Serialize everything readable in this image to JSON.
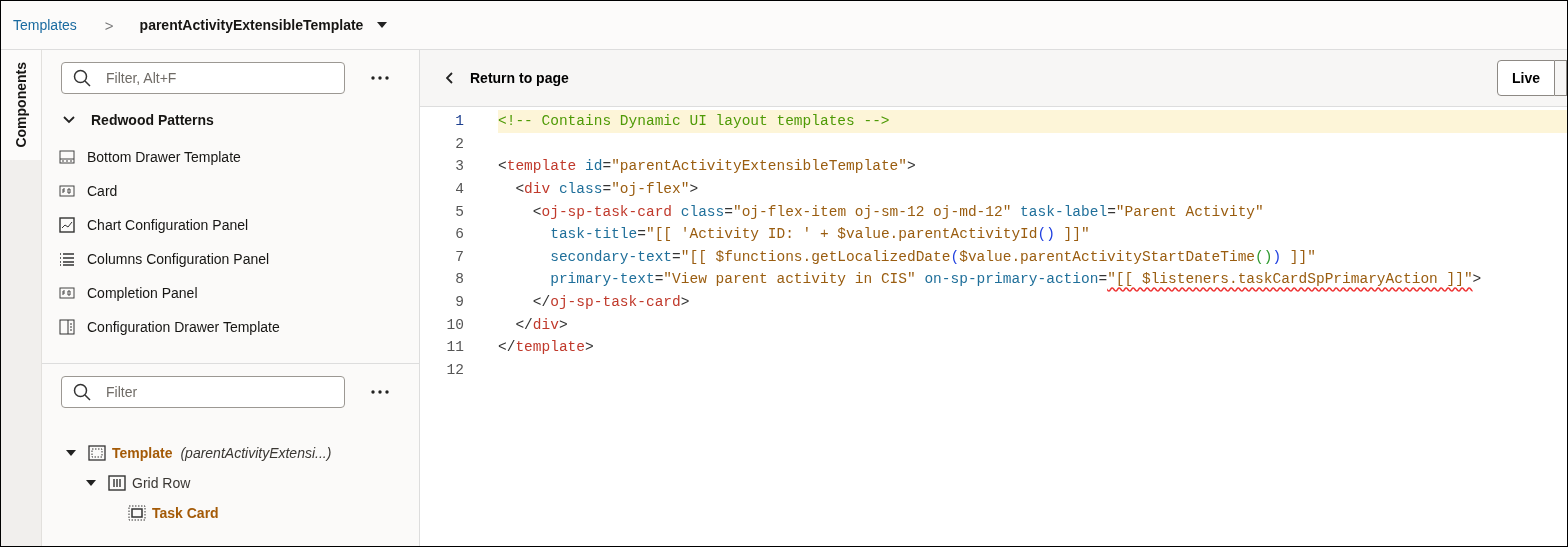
{
  "breadcrumb": {
    "parent": "Templates",
    "separator": ">",
    "current": "parentActivityExtensibleTemplate"
  },
  "side_tab": {
    "label": "Components",
    "selected": true
  },
  "components_panel": {
    "filter_placeholder": "Filter, Alt+F",
    "group": {
      "label": "Redwood Patterns",
      "expanded": true
    },
    "items": [
      {
        "label": "Bottom Drawer Template",
        "kind": "drawer"
      },
      {
        "label": "Card",
        "kind": "card"
      },
      {
        "label": "Chart Configuration Panel",
        "kind": "chart"
      },
      {
        "label": "Columns Configuration Panel",
        "kind": "list"
      },
      {
        "label": "Completion Panel",
        "kind": "card"
      },
      {
        "label": "Configuration Drawer Template",
        "kind": "panel"
      }
    ]
  },
  "structure_panel": {
    "filter_placeholder": "Filter",
    "tree": [
      {
        "label": "Template",
        "detail": "(parentActivityExtensi...)",
        "kind": "template",
        "emphasized": true,
        "expanded": true,
        "children": [
          {
            "label": "Grid Row",
            "kind": "grid",
            "emphasized": false,
            "expanded": true,
            "children": [
              {
                "label": "Task Card",
                "kind": "card",
                "emphasized": true
              }
            ]
          }
        ]
      }
    ]
  },
  "editor": {
    "back_label": "Return to page",
    "mode_button": "Live",
    "lines": [
      {
        "number": "1",
        "current": true,
        "tokens": [
          {
            "kind": "comment",
            "text": "<!-- Contains Dynamic UI layout templates -->"
          }
        ]
      },
      {
        "number": "2",
        "current": false
      },
      {
        "number": "3",
        "current": false,
        "tokens": [
          {
            "kind": "punct",
            "text": "<"
          },
          {
            "kind": "tag",
            "text": "template"
          },
          {
            "kind": "attr",
            "text": " id"
          },
          {
            "kind": "punct",
            "text": "="
          },
          {
            "kind": "string",
            "text": "\"parentActivityExtensibleTemplate\""
          },
          {
            "kind": "punct",
            "text": ">"
          }
        ]
      },
      {
        "number": "4",
        "current": false,
        "tokens": [
          {
            "kind": "punct",
            "text": "  <"
          },
          {
            "kind": "tag",
            "text": "div"
          },
          {
            "kind": "attr",
            "text": " class"
          },
          {
            "kind": "punct",
            "text": "="
          },
          {
            "kind": "string",
            "text": "\"oj-flex\""
          },
          {
            "kind": "punct",
            "text": ">"
          }
        ]
      },
      {
        "number": "5",
        "current": false,
        "tokens": [
          {
            "kind": "punct",
            "text": "    <"
          },
          {
            "kind": "tag",
            "text": "oj-sp-task-card"
          },
          {
            "kind": "attr",
            "text": " class"
          },
          {
            "kind": "punct",
            "text": "="
          },
          {
            "kind": "string",
            "text": "\"oj-flex-item oj-sm-12 oj-md-12\""
          },
          {
            "kind": "attr",
            "text": " task-label"
          },
          {
            "kind": "punct",
            "text": "="
          },
          {
            "kind": "string",
            "text": "\"Parent Activity\""
          }
        ]
      },
      {
        "number": "6",
        "current": false,
        "tokens": [
          {
            "kind": "attr",
            "text": "      task-title"
          },
          {
            "kind": "punct",
            "text": "="
          },
          {
            "kind": "string",
            "text": "\"[[ 'Activity ID: ' + $value.parentActivityId"
          },
          {
            "kind": "paren",
            "text": "()"
          },
          {
            "kind": "string",
            "text": " ]]\""
          }
        ]
      },
      {
        "number": "7",
        "current": false,
        "tokens": [
          {
            "kind": "attr",
            "text": "      secondary-text"
          },
          {
            "kind": "punct",
            "text": "="
          },
          {
            "kind": "string",
            "text": "\"[[ $functions.getLocalizedDate"
          },
          {
            "kind": "paren",
            "text": "("
          },
          {
            "kind": "string",
            "text": "$value.parentActivityStartDateTime"
          },
          {
            "kind": "paren2",
            "text": "()"
          },
          {
            "kind": "paren",
            "text": ")"
          },
          {
            "kind": "string",
            "text": " ]]\""
          }
        ]
      },
      {
        "number": "8",
        "current": false,
        "tokens": [
          {
            "kind": "attr",
            "text": "      primary-text"
          },
          {
            "kind": "punct",
            "text": "="
          },
          {
            "kind": "string",
            "text": "\"View parent activity in CIS\""
          },
          {
            "kind": "attr",
            "text": " on-sp-primary-action"
          },
          {
            "kind": "punct",
            "text": "="
          },
          {
            "kind": "error",
            "text": "\"[[ $listeners.taskCardSpPrimaryAction ]]\""
          },
          {
            "kind": "punct",
            "text": ">"
          }
        ]
      },
      {
        "number": "9",
        "current": false,
        "tokens": [
          {
            "kind": "punct",
            "text": "    </"
          },
          {
            "kind": "tag",
            "text": "oj-sp-task-card"
          },
          {
            "kind": "punct",
            "text": ">"
          }
        ]
      },
      {
        "number": "10",
        "current": false,
        "tokens": [
          {
            "kind": "punct",
            "text": "  </"
          },
          {
            "kind": "tag",
            "text": "div"
          },
          {
            "kind": "punct",
            "text": ">"
          }
        ]
      },
      {
        "number": "11",
        "current": false,
        "tokens": [
          {
            "kind": "punct",
            "text": "</"
          },
          {
            "kind": "tag",
            "text": "template"
          },
          {
            "kind": "punct",
            "text": ">"
          }
        ]
      },
      {
        "number": "12",
        "current": false
      }
    ]
  }
}
